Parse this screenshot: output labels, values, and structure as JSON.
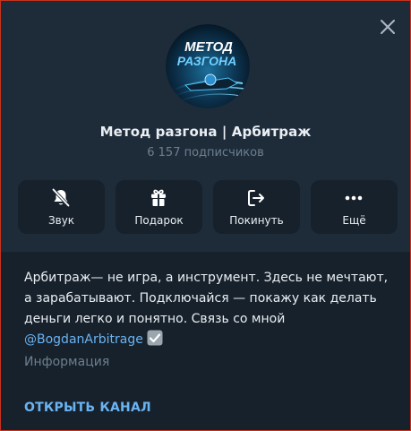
{
  "channel": {
    "name": "Метод разгона | Арбитраж",
    "subscribers": "6 157 подписчиков",
    "avatar": {
      "line1": "МЕТОД",
      "line2": "РАЗГОНА"
    }
  },
  "actions": [
    {
      "label": "Звук",
      "icon": "bell-muted-icon"
    },
    {
      "label": "Подарок",
      "icon": "gift-icon"
    },
    {
      "label": "Покинуть",
      "icon": "leave-icon"
    },
    {
      "label": "Ещё",
      "icon": "more-dots-icon"
    }
  ],
  "description": {
    "text": "Арбитраж— не игра, а инструмент. Здесь не мечтают, а зарабатывают. Подключайся — покажу как делать деньги легко и понятно. Связь со мной",
    "link": "@BogdanArbitrage",
    "label": "Информация"
  },
  "footer": {
    "open_channel": "ОТКРЫТЬ КАНАЛ"
  },
  "colors": {
    "background": "#17212b",
    "panel": "#1e2c3a",
    "accent": "#6ab3f3",
    "secondary_text": "#6d7f8f",
    "window_border": "#c8321e"
  }
}
